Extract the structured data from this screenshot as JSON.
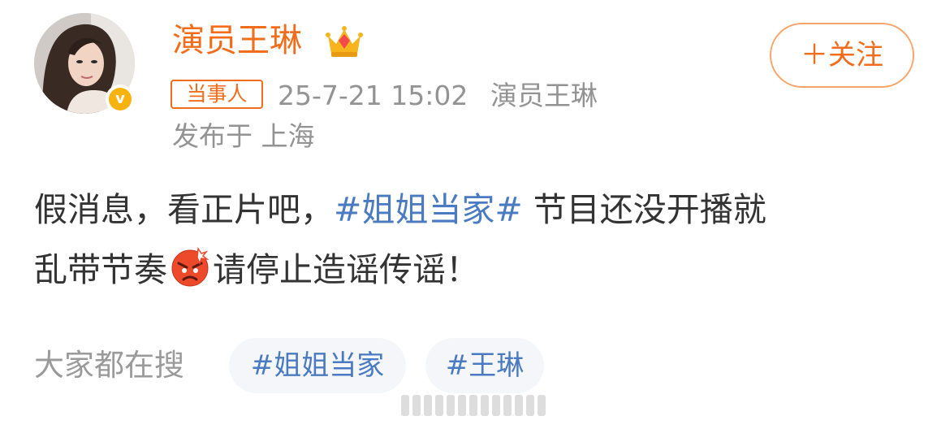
{
  "profile": {
    "username": "演员王琳",
    "vip_icon": "crown-icon",
    "verified_icon": "verified-v-icon",
    "verified_mark": "v",
    "avatar": "avatar"
  },
  "follow": {
    "label": "＋关注"
  },
  "meta": {
    "party_badge": "当事人",
    "time": "25-7-21 15:02",
    "source": "演员王琳",
    "location": "发布于 上海"
  },
  "post": {
    "line1_a": "假消息，看正片吧，",
    "line1_hashtag": "#姐姐当家#",
    "line1_b": " 节目还没开播就",
    "line2_a": "乱带节奏",
    "emoji": "angry-face-icon",
    "line2_b": "请停止造谣传谣！"
  },
  "searching": {
    "label": "大家都在搜",
    "topics": [
      "#姐姐当家",
      "#王琳"
    ]
  },
  "colors": {
    "accent": "#f26d1b",
    "link": "#4a7ac0",
    "meta_text": "#939393",
    "body_text": "#333333",
    "chip_bg": "#f4f6fa",
    "verified": "#f8b20e"
  }
}
